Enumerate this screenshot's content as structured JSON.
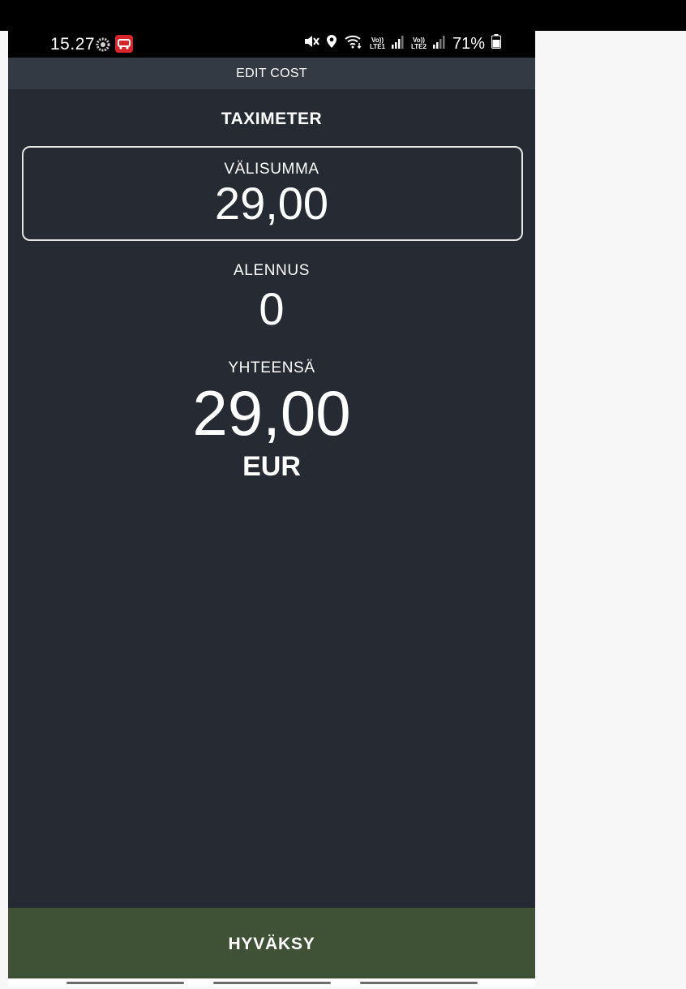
{
  "status_bar": {
    "time": "15.27",
    "battery": "71%",
    "lte1": "LTE1",
    "lte2": "LTE2",
    "volte": "Vo))"
  },
  "app_bar": {
    "title": "EDIT COST"
  },
  "section": {
    "title": "TAXIMETER"
  },
  "subtotal": {
    "label": "VÄLISUMMA",
    "value": "29,00"
  },
  "discount": {
    "label": "ALENNUS",
    "value": "0"
  },
  "total": {
    "label": "YHTEENSÄ",
    "value": "29,00",
    "currency": "EUR"
  },
  "actions": {
    "confirm_label": "HYVÄKSY"
  },
  "colors": {
    "background": "#252a33",
    "app_bar": "#343a44",
    "confirm_button": "#3f5235",
    "text": "#ffffff",
    "taxi_icon": "#d6262b"
  }
}
